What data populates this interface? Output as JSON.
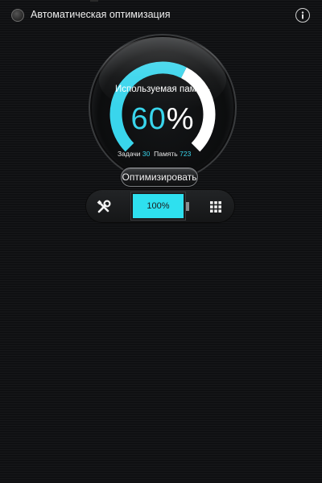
{
  "header": {
    "auto_optimize_label": "Автоматическая оптимизация",
    "toggle_icon": "radio-toggle-icon",
    "info_icon": "info-icon"
  },
  "gauge": {
    "label": "Используемая память",
    "value_number": "60",
    "value_percent": "%",
    "fill_fraction": 0.6,
    "accent_color": "#39d5ec",
    "track_color": "#ffffff"
  },
  "stats": {
    "tasks_label": "Задачи",
    "tasks_value": "30",
    "memory_label": "Память",
    "memory_value": "723"
  },
  "optimize_button": {
    "label": "Оптимизировать"
  },
  "dock": {
    "tools_icon": "tools-icon",
    "battery_level": "100%",
    "battery_fill_fraction": 1.0,
    "battery_color": "#2ee0ef",
    "grid_icon": "grid-icon"
  }
}
